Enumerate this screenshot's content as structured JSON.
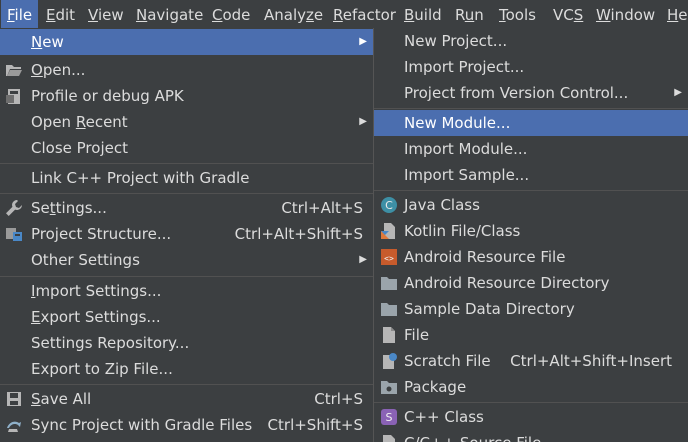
{
  "menubar": [
    {
      "pre": "",
      "mn": "F",
      "post": "ile"
    },
    {
      "pre": "",
      "mn": "E",
      "post": "dit"
    },
    {
      "pre": "",
      "mn": "V",
      "post": "iew"
    },
    {
      "pre": "",
      "mn": "N",
      "post": "avigate"
    },
    {
      "pre": "",
      "mn": "C",
      "post": "ode"
    },
    {
      "pre": "Analy",
      "mn": "z",
      "post": "e"
    },
    {
      "pre": "",
      "mn": "R",
      "post": "efactor"
    },
    {
      "pre": "",
      "mn": "B",
      "post": "uild"
    },
    {
      "pre": "R",
      "mn": "u",
      "post": "n"
    },
    {
      "pre": "",
      "mn": "T",
      "post": "ools"
    },
    {
      "pre": "VC",
      "mn": "S",
      "post": ""
    },
    {
      "pre": "",
      "mn": "W",
      "post": "indow"
    },
    {
      "pre": "",
      "mn": "H",
      "post": "e"
    }
  ],
  "file_menu": [
    {
      "pre": "",
      "mn": "N",
      "post": "ew",
      "arrow": "▶"
    },
    {
      "pre": "",
      "mn": "O",
      "post": "pen..."
    },
    {
      "pre": "Profile or debug APK",
      "mn": "",
      "post": ""
    },
    {
      "pre": "Open ",
      "mn": "R",
      "post": "ecent",
      "arrow": "▶"
    },
    {
      "pre": "Close Pro",
      "mn": "j",
      "post": "ect"
    },
    {
      "pre": "Link C++ Project with Gradle",
      "mn": "",
      "post": ""
    },
    {
      "pre": "Se",
      "mn": "t",
      "post": "tings...",
      "shortcut": "Ctrl+Alt+S"
    },
    {
      "pre": "Project Structure...",
      "mn": "",
      "post": "",
      "shortcut": "Ctrl+Alt+Shift+S"
    },
    {
      "pre": "Other Settings",
      "mn": "",
      "post": "",
      "arrow": "▶"
    },
    {
      "pre": "",
      "mn": "I",
      "post": "mport Settings..."
    },
    {
      "pre": "",
      "mn": "E",
      "post": "xport Settings..."
    },
    {
      "pre": "Settings Repository...",
      "mn": "",
      "post": ""
    },
    {
      "pre": "Export to Zip File...",
      "mn": "",
      "post": ""
    },
    {
      "pre": "",
      "mn": "S",
      "post": "ave All",
      "shortcut": "Ctrl+S"
    },
    {
      "pre": "Sync Project with Gradle Files",
      "mn": "",
      "post": "",
      "shortcut": "Ctrl+Shift+S"
    }
  ],
  "new_menu": [
    {
      "text": "New Project...",
      "arrow": ""
    },
    {
      "text": "Import Project..."
    },
    {
      "text": "Project from Version Control...",
      "arrow": "▶"
    },
    {
      "text": "New Module..."
    },
    {
      "text": "Import Module..."
    },
    {
      "text": "Import Sample..."
    },
    {
      "text": "Java Class",
      "icon": "C"
    },
    {
      "text": "Kotlin File/Class"
    },
    {
      "text": "Android Resource File",
      "icon": "<>"
    },
    {
      "text": "Android Resource Directory"
    },
    {
      "text": "Sample Data Directory"
    },
    {
      "text": "File"
    },
    {
      "text": "Scratch File",
      "shortcut": "Ctrl+Alt+Shift+Insert"
    },
    {
      "text": "Package"
    },
    {
      "text": "C++ Class",
      "icon": "S"
    },
    {
      "text": "C/C++ Source File"
    }
  ],
  "colors": {
    "selection": "#4b6eaf",
    "menu_bg": "#3c3f41",
    "text": "#dcdcdc"
  }
}
